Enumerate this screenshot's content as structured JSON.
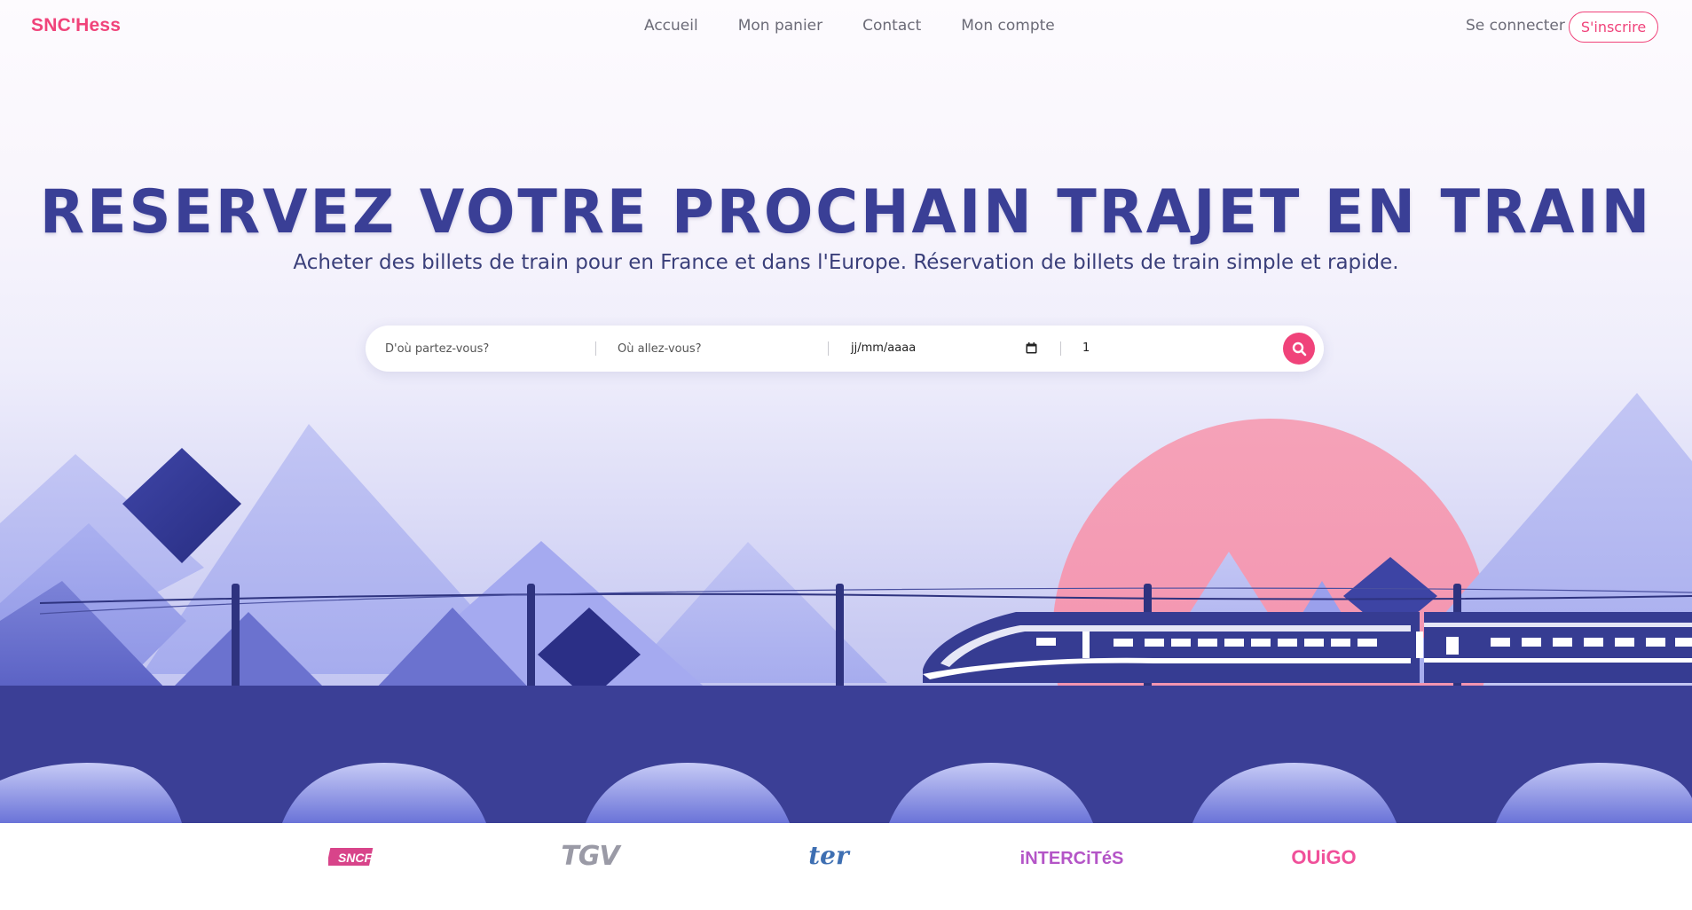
{
  "brand": "SNC'Hess",
  "nav": {
    "links": [
      "Accueil",
      "Mon panier",
      "Contact",
      "Mon compte"
    ],
    "login": "Se connecter",
    "signup": "S'inscrire"
  },
  "hero": {
    "title": "RESERVEZ VOTRE PROCHAIN TRAJET EN TRAIN",
    "subtitle": "Acheter des billets de train pour en France et dans l'Europe. Réservation de billets de train simple et rapide."
  },
  "search": {
    "from_placeholder": "D'où partez-vous?",
    "to_placeholder": "Où allez-vous?",
    "date_placeholder": "jj/mm/aaaa",
    "passengers": "1",
    "calendar_icon": "calendar-icon",
    "search_icon": "search-icon"
  },
  "partners": {
    "logos": [
      "SNCF",
      "TGV",
      "ter",
      "iNTERCiTéS",
      "OUiGO"
    ]
  },
  "colors": {
    "accent": "#f0437a",
    "primary": "#3a3f96",
    "sun": "#f7a3bc",
    "bridge": "#3b3f96"
  }
}
